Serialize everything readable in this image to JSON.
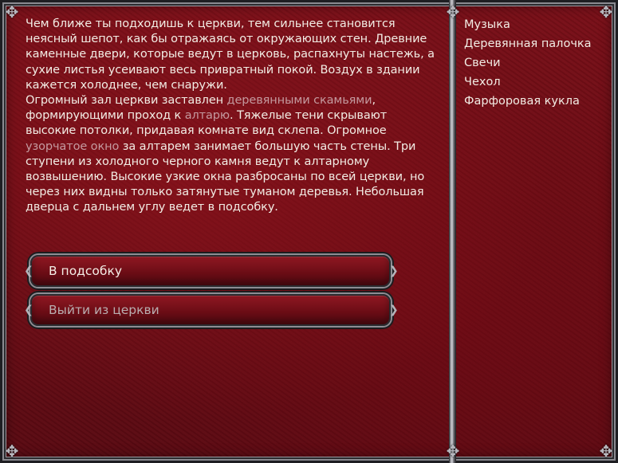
{
  "story": {
    "p1": "Чем ближе ты подходишь к церкви, тем сильнее становится неясный шепот, как бы отражаясь от окружающих стен. Древние каменные двери, которые ведут в церковь, распахнуты настежь, а сухие листья усеивают весь привратный покой. Воздух в здании кажется холоднее, чем снаружи.",
    "p2_a": "Огромный зал церкви заставлен ",
    "link_pews": "деревянными скамьями",
    "p2_b": ", формирующими проход к ",
    "link_altar": "алтарю",
    "p2_c": ". Тяжелые тени скрывают высокие потолки, придавая комнате вид склепа. Огромное ",
    "link_window": "узорчатое окно",
    "p2_d": " за алтарем занимает большую часть стены. Три ступени из холодного черного камня ведут к алтарному возвышению. Высокие узкие окна разбросаны по всей церкви, но через них видны только затянутые туманом деревья. Небольшая дверца с дальнем углу ведет в подсобку."
  },
  "inventory": {
    "items": [
      "Музыка",
      "Деревянная палочка",
      "Свечи",
      "Чехол",
      "Фарфоровая кукла"
    ]
  },
  "choices": {
    "c1": "В подсобку",
    "c2": "Выйти из церкви"
  },
  "colors": {
    "background": "#6a0c14",
    "text": "#f2ece4",
    "link": "#c49a9f",
    "frame": "#9a9aa0"
  }
}
